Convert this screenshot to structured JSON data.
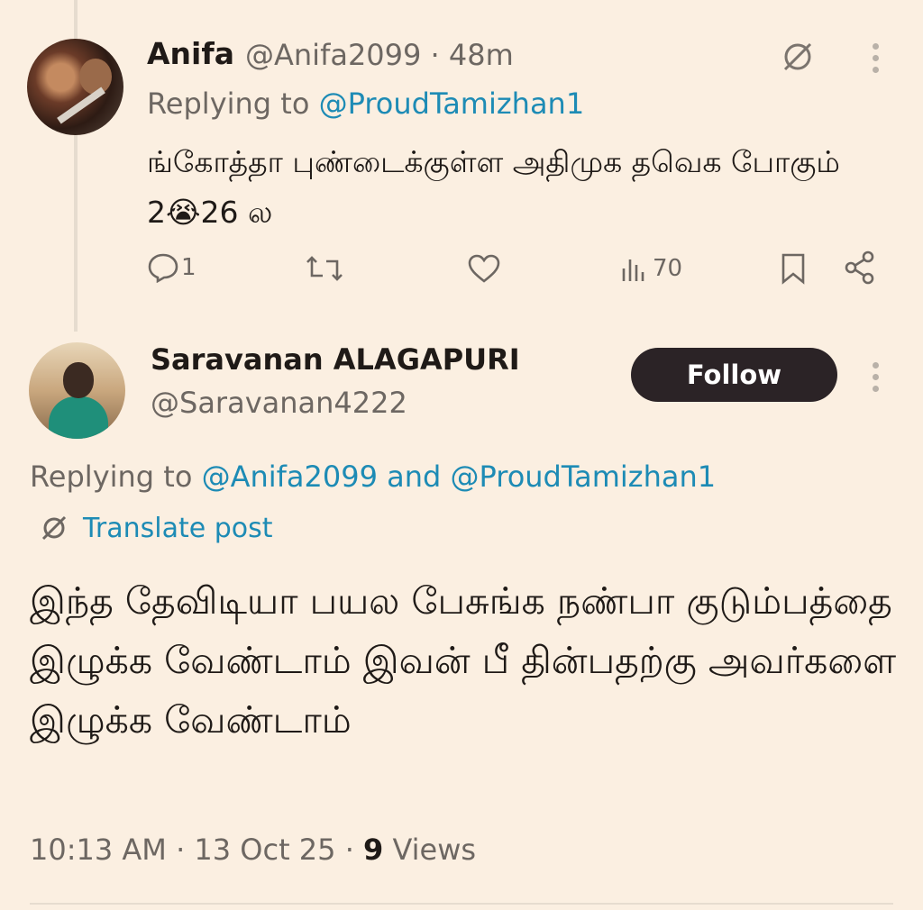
{
  "tweet1": {
    "name": "Anifa",
    "handle": "@Anifa2099",
    "time": "48m",
    "replying_prefix": "Replying to",
    "replying_to": "@ProudTamizhan1",
    "text": "ங்கோத்தா புண்டைக்குள்ள அதிமுக தவெக போகும் 2😭26 ல",
    "reply_count": "1",
    "view_count": "70"
  },
  "tweet2": {
    "name": "Saravanan ALAGAPURI",
    "handle": "@Saravanan4222",
    "follow_label": "Follow",
    "replying_prefix": "Replying to",
    "replying_to_1": "@Anifa2099",
    "replying_and": "and",
    "replying_to_2": "@ProudTamizhan1",
    "translate_label": "Translate post",
    "text": "இந்த தேவிடியா பயல பேசுங்க நண்பா குடும்பத்தை இழுக்க வேண்டாம் இவன் பீ தின்பதற்கு அவர்களை இழுக்க வேண்டாம்",
    "time": "10:13 AM",
    "date": "13 Oct 25",
    "views_count": "9",
    "views_label": "Views"
  },
  "icons": {
    "translate": "translate-icon",
    "more": "more-vertical-icon",
    "reply": "reply-icon",
    "repost": "repost-icon",
    "like": "heart-icon",
    "views": "views-icon",
    "bookmark": "bookmark-icon",
    "share": "share-icon"
  },
  "colors": {
    "background": "#fbefe1",
    "link": "#1d8bb5",
    "follow_button": "#2b2326"
  }
}
